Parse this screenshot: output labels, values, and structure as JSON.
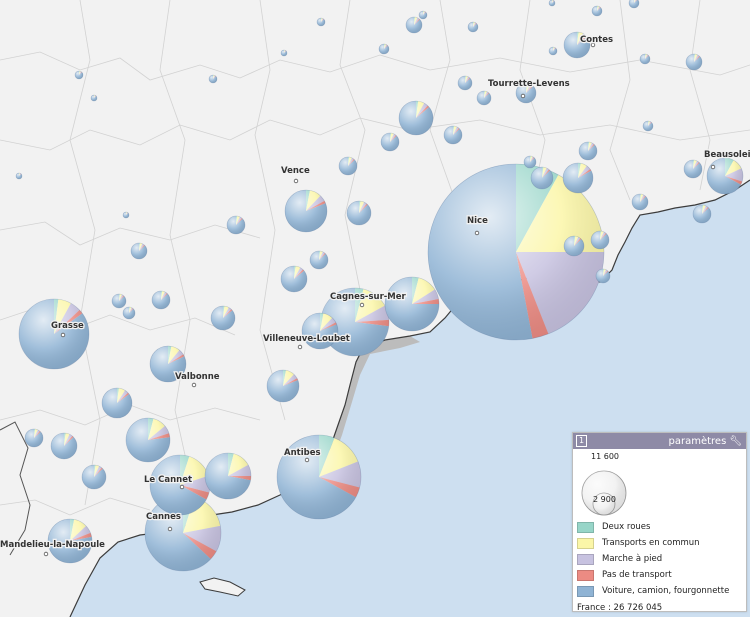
{
  "categories": [
    {
      "label": "Deux roues",
      "color": "#97d5c8"
    },
    {
      "label": "Transports en commun",
      "color": "#fbf6a8"
    },
    {
      "label": "Marche à pied",
      "color": "#c7c2e0"
    },
    {
      "label": "Pas de transport",
      "color": "#ec8b83"
    },
    {
      "label": "Voiture, camion, fourgonnette",
      "color": "#8fb3d4"
    }
  ],
  "legend": {
    "number": "1",
    "title": "paramètres",
    "size_large": "11 600",
    "size_small": "2 900",
    "total": "France : 26 726 045"
  },
  "cities": [
    {
      "name": "Contes"
    },
    {
      "name": "Tourrette-Levens"
    },
    {
      "name": "Beausoleil"
    },
    {
      "name": "Vence"
    },
    {
      "name": "Nice"
    },
    {
      "name": "Grasse"
    },
    {
      "name": "Cagnes-sur-Mer"
    },
    {
      "name": "Villeneuve-Loubet"
    },
    {
      "name": "Valbonne"
    },
    {
      "name": "Antibes"
    },
    {
      "name": "Le Cannet"
    },
    {
      "name": "Cannes"
    },
    {
      "name": "Mandelieu-la-Napoule"
    }
  ],
  "colors": {
    "sea": "#cddff0",
    "land": "#f2f2f2",
    "borders": "#d2d2d2",
    "legend_header": "#8e8aa6"
  }
}
